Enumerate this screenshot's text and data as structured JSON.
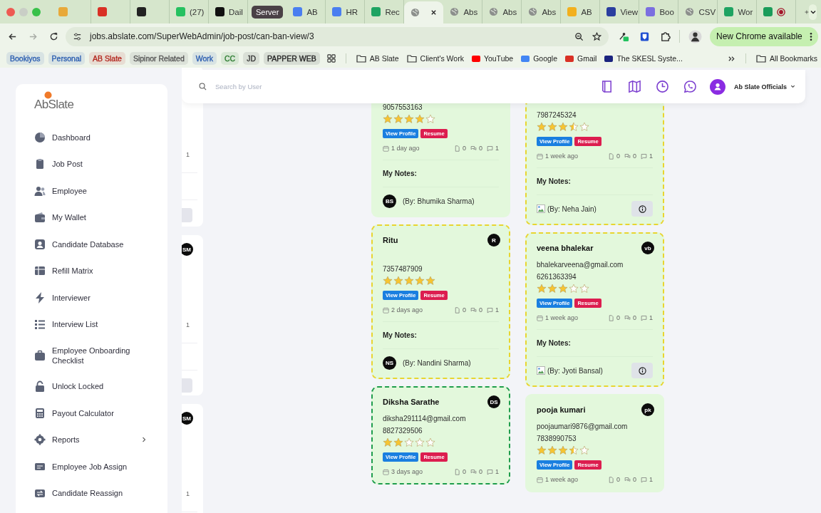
{
  "browser": {
    "tabs": [
      {
        "kind": "app",
        "color": "#e8a93a",
        "selected": false
      },
      {
        "kind": "app",
        "color": "#d93025",
        "selected": false
      },
      {
        "kind": "app",
        "color": "#222222",
        "selected": false
      },
      {
        "kind": "app",
        "color": "#25c160",
        "title": "(27)",
        "selected": false
      },
      {
        "kind": "app",
        "color": "#111111",
        "title": "Dail",
        "selected": false
      },
      {
        "kind": "group",
        "title": "Server",
        "selected": false
      },
      {
        "kind": "app",
        "color": "#4a7ef0",
        "title": "AB",
        "selected": false
      },
      {
        "kind": "app",
        "color": "#4a7ef0",
        "title": "HR",
        "selected": false
      },
      {
        "kind": "app",
        "color": "#1ea362",
        "title": "Rec",
        "selected": false
      },
      {
        "kind": "globe",
        "selected": true
      },
      {
        "kind": "globe",
        "title": "Abs",
        "selected": false
      },
      {
        "kind": "globe",
        "title": "Abs",
        "selected": false
      },
      {
        "kind": "globe",
        "title": "Abs",
        "selected": false
      },
      {
        "kind": "app",
        "color": "#f2b01e",
        "title": "AB",
        "selected": false
      },
      {
        "kind": "app",
        "color": "#2a3e9f",
        "title": "View",
        "selected": false
      },
      {
        "kind": "app",
        "color": "#7b6fe0",
        "title": "Boo",
        "selected": false
      },
      {
        "kind": "globe",
        "title": "CSV",
        "selected": false
      },
      {
        "kind": "app",
        "color": "#1ea362",
        "title": "Wor",
        "selected": false
      },
      {
        "kind": "app",
        "color": "#1a9c5a",
        "recording": true,
        "selected": false
      }
    ],
    "url": "jobs.abslate.com/SuperWebAdmin/job-post/can-ban-view/3",
    "update_button": "New Chrome available",
    "bookmarks": [
      {
        "kind": "chip",
        "label": "Bookiyos",
        "color": "#2a5db0"
      },
      {
        "kind": "chip",
        "label": "Personal",
        "color": "#2a5db0"
      },
      {
        "kind": "chip",
        "label": "AB Slate",
        "color": "#b3261e"
      },
      {
        "kind": "chip",
        "label": "Sipinor Related",
        "color": "#555555"
      },
      {
        "kind": "chip",
        "label": "Work",
        "color": "#2a5db0"
      },
      {
        "kind": "chip",
        "label": "CC",
        "color": "#2e7d32"
      },
      {
        "kind": "chip",
        "label": "JD",
        "color": "#333333"
      },
      {
        "kind": "chip",
        "label": "PAPPER WEB",
        "color": "#222222"
      },
      {
        "kind": "apps"
      },
      {
        "kind": "folder",
        "label": "AB Slate"
      },
      {
        "kind": "folder",
        "label": "Client's Work"
      },
      {
        "kind": "site",
        "label": "YouTube",
        "color": "#ff0000"
      },
      {
        "kind": "site",
        "label": "Google",
        "color": "#4285f4"
      },
      {
        "kind": "site",
        "label": "Gmail",
        "color": "#d93025"
      },
      {
        "kind": "site",
        "label": "The SKESL Syste...",
        "color": "#1a237e"
      }
    ],
    "all_bookmarks": "All Bookmarks"
  },
  "sidebar": {
    "logo": "AbSlate",
    "items": [
      {
        "label": "Dashboard"
      },
      {
        "label": "Job Post"
      },
      {
        "label": "Employee"
      },
      {
        "label": "My Wallet"
      },
      {
        "label": "Candidate Database"
      },
      {
        "label": "Refill Matrix"
      },
      {
        "label": "Interviewer"
      },
      {
        "label": "Interview List"
      },
      {
        "label": "Employee Onboarding Checklist"
      },
      {
        "label": "Unlock Locked"
      },
      {
        "label": "Payout Calculator"
      },
      {
        "label": "Reports",
        "expandable": true
      },
      {
        "label": "Employee Job Assign"
      },
      {
        "label": "Candidate Reassign"
      }
    ]
  },
  "header": {
    "search": {
      "placeholder": "Search by User"
    },
    "user": "Ab Slate Officials"
  },
  "board": {
    "fragment_cards": [
      {
        "comments": "1",
        "info_button": true
      },
      {
        "avatar": "SM",
        "comments": "1",
        "info_button": true
      },
      {
        "avatar": "SM",
        "comments": "1"
      }
    ],
    "columns": [
      {
        "cards": [
          {
            "phone": "9057553163",
            "stars": 4,
            "profile_button": "View Profile",
            "resume_button": "Resume",
            "date": "1 day ago",
            "files": "0",
            "chats": "0",
            "comments": "1",
            "notes_label": "My Notes:",
            "author": {
              "initials": "BS",
              "text": "(By: Bhumika Sharma)"
            }
          },
          {
            "name": "Ritu",
            "avatar": "R",
            "phone": "7357487909",
            "stars": 5,
            "profile_button": "View Profile",
            "resume_button": "Resume",
            "date": "2 days ago",
            "files": "0",
            "chats": "0",
            "comments": "1",
            "notes_label": "My Notes:",
            "author": {
              "initials": "NS",
              "text": "(By: Nandini Sharma)"
            },
            "color": "#e8d530"
          },
          {
            "name": "Diksha Sarathe",
            "avatar": "DS",
            "email": "diksha291114@gmail.com",
            "phone": "8827329506",
            "stars": 2,
            "profile_button": "View Profile",
            "resume_button": "Resume",
            "date": "3 days ago",
            "files": "0",
            "chats": "0",
            "comments": "1",
            "color": "#1f9d4c"
          }
        ]
      },
      {
        "cards": [
          {
            "phone": "7987245324",
            "stars": 3.5,
            "profile_button": "View Profile",
            "resume_button": "Resume",
            "date": "1 week ago",
            "files": "0",
            "chats": "0",
            "comments": "1",
            "notes_label": "My Notes:",
            "author": {
              "text": "(By: Neha Jain)"
            },
            "info_button": true,
            "color": "#e8d530"
          },
          {
            "name": "veena bhalekar",
            "avatar": "vb",
            "email": "bhalekarveena@gmail.com",
            "phone": "6261363394",
            "stars": 3,
            "profile_button": "View Profile",
            "resume_button": "Resume",
            "date": "1 week ago",
            "files": "0",
            "chats": "0",
            "comments": "1",
            "notes_label": "My Notes:",
            "author": {
              "text": "(By: Jyoti Bansal)"
            },
            "info_button": true,
            "color": "#e8d530"
          },
          {
            "name": "pooja kumari",
            "avatar": "pk",
            "email": "poojaumari9876@gmail.com",
            "phone": "7838990753",
            "stars": 3.5,
            "profile_button": "View Profile",
            "resume_button": "Resume",
            "date": "1 week ago",
            "files": "0",
            "chats": "0",
            "comments": "1"
          }
        ]
      }
    ]
  }
}
